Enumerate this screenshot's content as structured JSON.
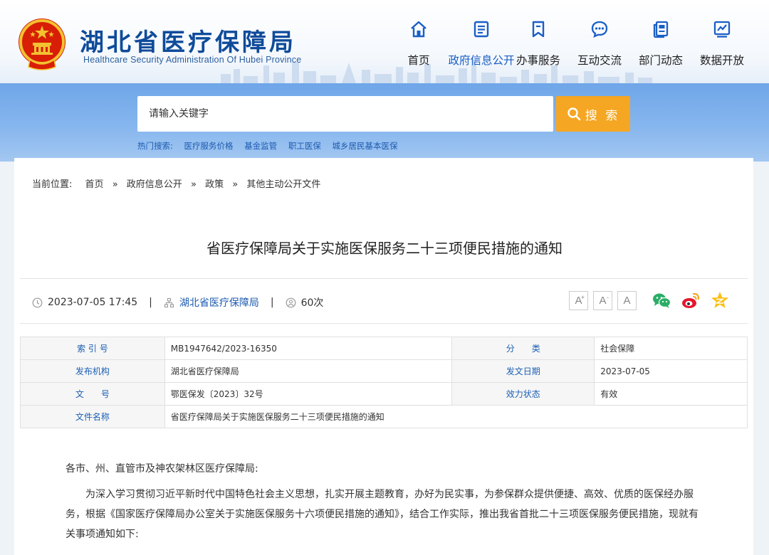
{
  "header": {
    "title": "湖北省医疗保障局",
    "subtitle": "Healthcare Security Administration Of Hubei Province"
  },
  "nav": [
    {
      "label": "首页",
      "icon": "home-icon",
      "active": false
    },
    {
      "label": "政府信息公开",
      "icon": "document-icon",
      "active": true
    },
    {
      "label": "办事服务",
      "icon": "bookmark-icon",
      "active": false
    },
    {
      "label": "互动交流",
      "icon": "chat-icon",
      "active": false
    },
    {
      "label": "部门动态",
      "icon": "news-icon",
      "active": false
    },
    {
      "label": "数据开放",
      "icon": "chart-icon",
      "active": false
    }
  ],
  "search": {
    "placeholder": "请输入关键字",
    "button_label": "搜 索",
    "hot_label": "热门搜索:",
    "hot_items": [
      "医疗服务价格",
      "基金监管",
      "职工医保",
      "城乡居民基本医保"
    ]
  },
  "breadcrumb": {
    "prefix": "当前位置:",
    "items": [
      "首页",
      "政府信息公开",
      "政策",
      "其他主动公开文件"
    ],
    "separator": "»"
  },
  "article": {
    "title": "省医疗保障局关于实施医保服务二十三项便民措施的通知",
    "datetime": "2023-07-05 17:45",
    "source": "湖北省医疗保障局",
    "views": "60次",
    "font_buttons": [
      "A",
      "A",
      "A"
    ]
  },
  "info_table": {
    "index_label": "索 引 号",
    "index_value": "MB1947642/2023-16350",
    "category_label": "分　　类",
    "category_value": "社会保障",
    "issuer_label": "发布机构",
    "issuer_value": "湖北省医疗保障局",
    "date_label": "发文日期",
    "date_value": "2023-07-05",
    "docno_label": "文　　号",
    "docno_value": "鄂医保发〔2023〕32号",
    "status_label": "效力状态",
    "status_value": "有效",
    "filename_label": "文件名称",
    "filename_value": "省医疗保障局关于实施医保服务二十三项便民措施的通知"
  },
  "body": {
    "greeting": "各市、州、直管市及神农架林区医疗保障局:",
    "paragraph": "为深入学习贯彻习近平新时代中国特色社会主义思想，扎实开展主题教育，办好为民实事，为参保群众提供便捷、高效、优质的医保经办服务，根据《国家医疗保障局办公室关于实施医保服务十六项便民措施的通知》，结合工作实际，推出我省首批二十三项医保服务便民措施，现就有关事项通知如下:"
  },
  "colors": {
    "brand_blue": "#0f4b9a",
    "link_blue": "#1d5bb0",
    "search_orange": "#f5a623",
    "band_blue": "#7fb0ec"
  }
}
